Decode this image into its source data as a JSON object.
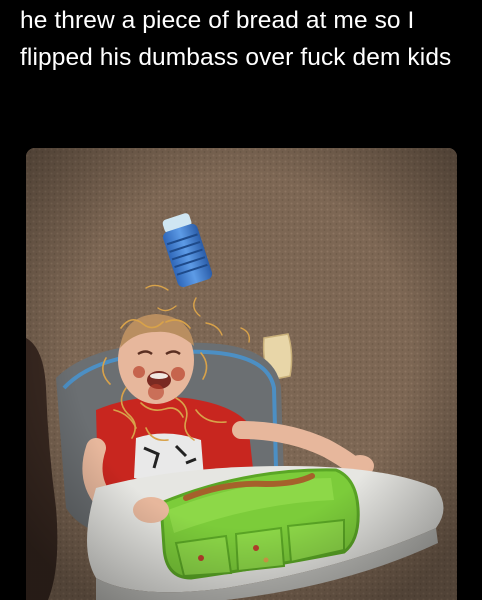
{
  "post": {
    "caption": "he threw a piece of bread at me so I flipped his dumbass over fuck dem kids"
  },
  "photo": {
    "description_icon": "image-photo",
    "colors": {
      "carpet": "#7d6754",
      "high_chair": "#6b6f72",
      "tray": "#e6e6e2",
      "plate": "#7ccc3a",
      "shirt": "#c8261f",
      "cup": "#3f7fd0",
      "bread": "#e8d6a8",
      "spaghetti": "#d8a24a"
    }
  }
}
